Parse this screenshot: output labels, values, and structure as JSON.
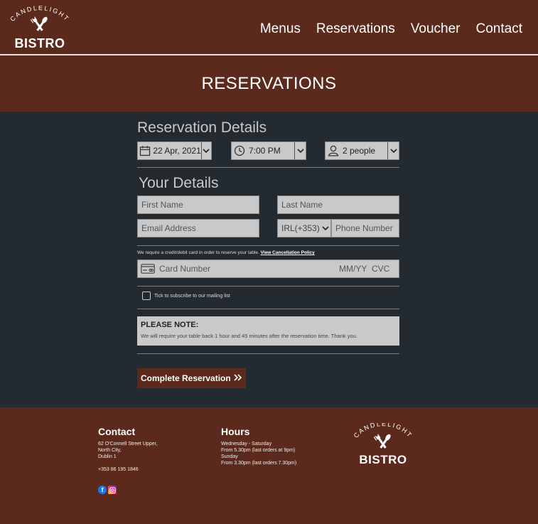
{
  "header": {
    "logo": {
      "arc_text": "CANDLELIGHT",
      "brand": "BISTRO"
    },
    "nav": [
      "Menus",
      "Reservations",
      "Voucher",
      "Contact"
    ],
    "page_title": "RESERVATIONS"
  },
  "reservation": {
    "title": "Reservation Details",
    "date": "22 Apr, 2021",
    "time": "7:00 PM",
    "people": "2 people"
  },
  "details": {
    "title": "Your Details",
    "first_name_placeholder": "First Name",
    "last_name_placeholder": "Last Name",
    "email_placeholder": "Email Address",
    "country_code": "IRL(+353)",
    "phone_placeholder": "Phone Number"
  },
  "payment": {
    "note": "We require a credit/debit card in order to reserve your table.",
    "policy_link": "View Cancellation Policy",
    "card_placeholder": "Card Number",
    "expiry_placeholder": "MM/YY",
    "cvc_placeholder": "CVC"
  },
  "subscribe_label": "Tick to subscribe to our mailing list",
  "notice": {
    "title": "PLEASE NOTE:",
    "body": "We will require your table back 1 hour and 45 minutes after the reservation time. Thank you."
  },
  "submit_label": "Complete Reservation",
  "footer": {
    "contact": {
      "title": "Contact",
      "address": [
        "62 O'Connell Street Upper,",
        "North City,",
        "Dublin 1"
      ],
      "phone": "+353 86 195 1846"
    },
    "hours": {
      "title": "Hours",
      "lines": [
        "Wednesday - Saturday",
        "From 5.30pm (last orders at 9pm)",
        "Sunday",
        "From 3.30pm (last orders 7.30pm)"
      ]
    },
    "logo": {
      "arc_text": "CANDLELIGHT",
      "brand": "BISTRO"
    }
  },
  "colors": {
    "brand_brown": "#5b2a1c",
    "body_dark": "#232a30",
    "input_grey": "#c9c9c9"
  },
  "icons": [
    "fork-knife-icon",
    "calendar-icon",
    "clock-icon",
    "person-icon",
    "chevron-down-icon",
    "credit-card-icon",
    "double-chevron-right-icon",
    "facebook-icon",
    "instagram-icon"
  ]
}
